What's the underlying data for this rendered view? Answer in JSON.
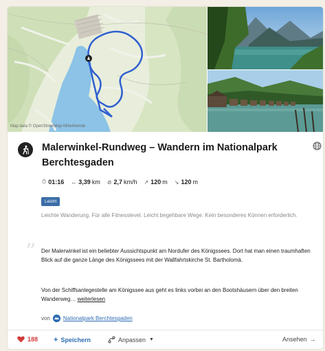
{
  "map": {
    "credit": "Map data © OpenStreetMap-Mitwirkende"
  },
  "tour": {
    "title": "Malerwinkel-Rundweg – Wandern im Nationalpark Berchtesgaden",
    "stats": {
      "duration": "01:16",
      "distance": "3,39",
      "distance_unit": "km",
      "speed": "2,7",
      "speed_unit": "km/h",
      "ascent": "120",
      "ascent_unit": "m",
      "descent": "120",
      "descent_unit": "m"
    },
    "difficulty_badge": "Leicht",
    "difficulty_text": "Leichte Wanderung. Für alle Fitnesslevel. Leicht begehbare Wege. Kein besonderes Können erforderlich.",
    "description_1": "Der Malerwinkel ist ein beliebter Aussichtspunkt am Nordufer des Königssees. Dort hat man einen traumhaften Blick auf die ganze Länge des Königssees mit der Wallfahrtskirche St. Bartholomä.",
    "description_2": "Von der Schiffsanlegestelle am Königssee aus geht es links vorbei an den Bootshäusern über den breiten Wanderweg…",
    "read_more": "weiterlesen",
    "source_prefix": "von",
    "source_name": "Nationalpark Berchtesgaden"
  },
  "footer": {
    "likes": "188",
    "save_label": "Speichern",
    "adjust_label": "Anpassen",
    "view_label": "Ansehen"
  },
  "colors": {
    "accent": "#2f6db3",
    "like": "#d23a3a",
    "badge": "#3b6ea8"
  }
}
